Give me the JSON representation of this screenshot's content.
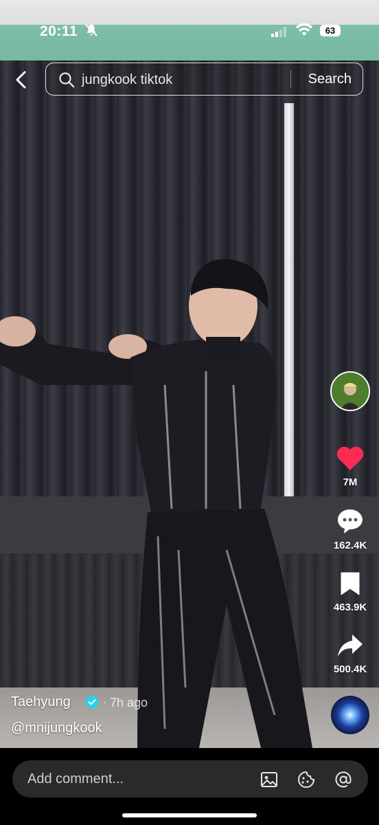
{
  "status_bar": {
    "time": "20:11",
    "battery": "63"
  },
  "search": {
    "query": "jungkook tiktok",
    "button_label": "Search"
  },
  "rail": {
    "likes": "7M",
    "comments": "162.4K",
    "saves": "463.9K",
    "shares": "500.4K"
  },
  "caption": {
    "author": "Taehyung",
    "separator": "·",
    "time_ago": "7h ago",
    "handle": "@mnijungkook"
  },
  "comment_bar": {
    "placeholder": "Add comment..."
  },
  "colors": {
    "like": "#fe2c55",
    "verified": "#20d5ec"
  }
}
